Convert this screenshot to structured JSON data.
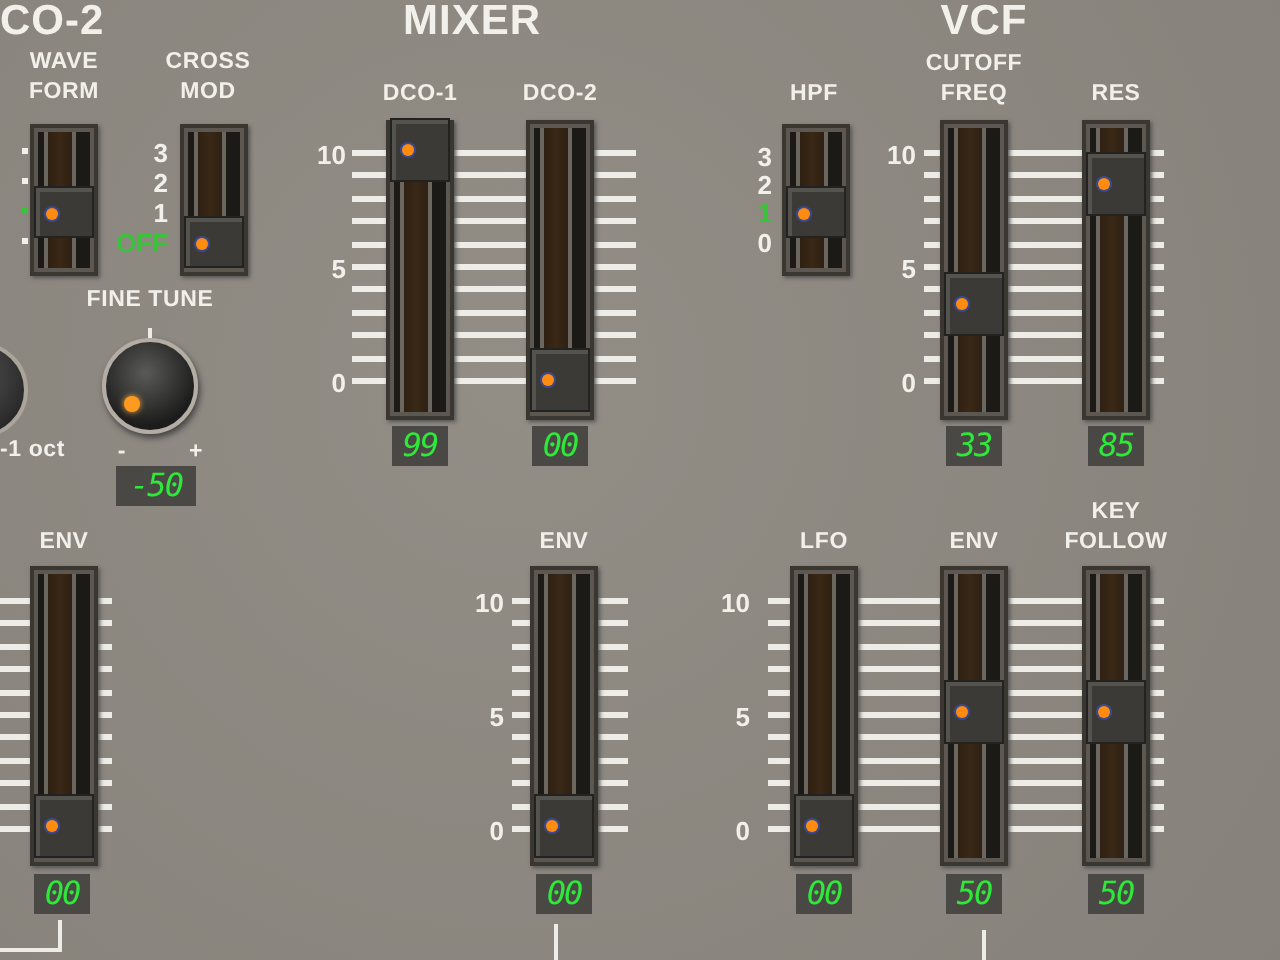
{
  "dco2": {
    "title": "CO-2",
    "waveform": {
      "label": [
        "WAVE",
        "FORM"
      ],
      "options": [
        {
          "selected": false
        },
        {
          "selected": false
        },
        {
          "selected": true
        },
        {
          "selected": false
        }
      ]
    },
    "cross_mod": {
      "label": [
        "CROSS",
        "MOD"
      ],
      "options": [
        {
          "label": "3",
          "selected": false
        },
        {
          "label": "2",
          "selected": false
        },
        {
          "label": "1",
          "selected": false
        },
        {
          "label": "OFF",
          "selected": true
        }
      ]
    },
    "octave_label": "-1 oct",
    "fine_tune": {
      "label": "FINE TUNE",
      "min_label": "-",
      "max_label": "+",
      "display": "-50"
    },
    "env": {
      "label": [
        "ENV"
      ],
      "display": "00"
    }
  },
  "mixer": {
    "title": "MIXER",
    "scale": [
      "10",
      "5",
      "0"
    ],
    "sliders": [
      {
        "label": [
          "DCO-1"
        ],
        "display": "99"
      },
      {
        "label": [
          "DCO-2"
        ],
        "display": "00"
      }
    ],
    "env_scale": [
      "10",
      "5",
      "0"
    ],
    "env": {
      "label": [
        "ENV"
      ],
      "display": "00"
    }
  },
  "vcf": {
    "title": "VCF",
    "hpf": {
      "label": [
        "HPF"
      ],
      "options": [
        {
          "label": "3",
          "selected": false
        },
        {
          "label": "2",
          "selected": false
        },
        {
          "label": "1",
          "selected": true
        },
        {
          "label": "0",
          "selected": false
        }
      ]
    },
    "scale": [
      "10",
      "5",
      "0"
    ],
    "sliders": [
      {
        "label": [
          "CUTOFF",
          "FREQ"
        ],
        "display": "33"
      },
      {
        "label": [
          "RES"
        ],
        "display": "85"
      }
    ],
    "mod_scale": [
      "10",
      "5",
      "0"
    ],
    "mod_sliders": [
      {
        "label": [
          "LFO"
        ],
        "display": "00"
      },
      {
        "label": [
          "ENV"
        ],
        "display": "50"
      },
      {
        "label": [
          "KEY",
          "FOLLOW"
        ],
        "display": "50"
      }
    ]
  }
}
